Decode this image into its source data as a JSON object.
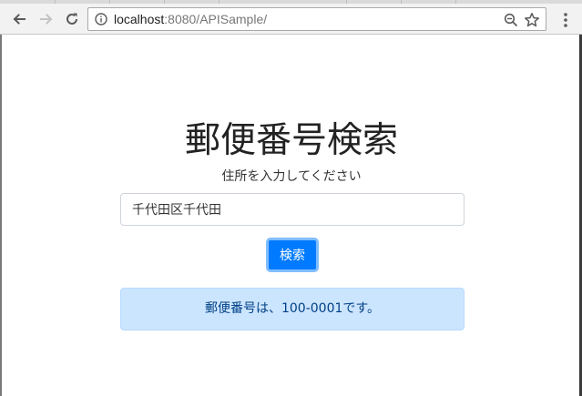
{
  "browser": {
    "url_host": "localhost",
    "url_rest": ":8080/APISample/",
    "icons": {
      "back": "back-arrow-icon",
      "forward": "forward-arrow-icon",
      "reload": "reload-icon",
      "info": "info-icon",
      "zoom": "zoom-out-icon",
      "bookmark": "star-icon",
      "menu": "kebab-menu-icon"
    }
  },
  "page": {
    "title": "郵便番号検索",
    "subtitle": "住所を入力してください",
    "address_value": "千代田区千代田",
    "search_label": "検索",
    "result_text": "郵便番号は、100-0001です。"
  },
  "colors": {
    "primary": "#007bff",
    "alert_bg": "#cce5ff",
    "alert_text": "#004085"
  }
}
